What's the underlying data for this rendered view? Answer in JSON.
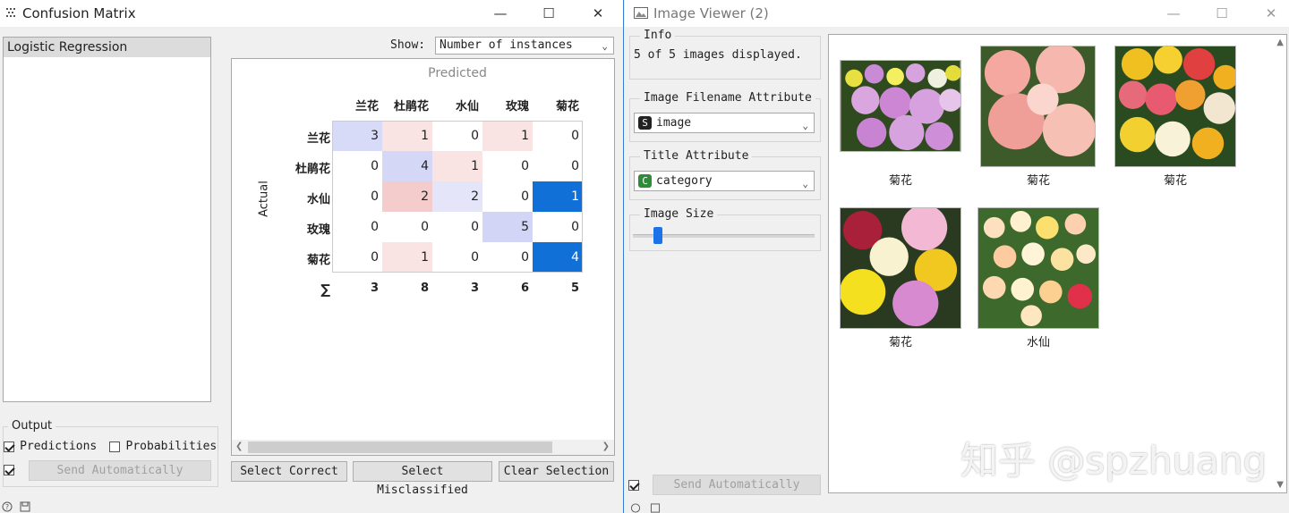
{
  "confusion_window": {
    "title": "Confusion Matrix",
    "classifiers": [
      "Logistic Regression"
    ],
    "show_label": "Show:",
    "show_value": "Number of instances",
    "predicted_label": "Predicted",
    "actual_label": "Actual",
    "classes": [
      "兰花",
      "杜鹃花",
      "水仙",
      "玫瑰",
      "菊花"
    ],
    "matrix": [
      [
        3,
        1,
        0,
        1,
        0
      ],
      [
        0,
        4,
        1,
        0,
        0
      ],
      [
        0,
        2,
        2,
        0,
        1
      ],
      [
        0,
        0,
        0,
        5,
        0
      ],
      [
        0,
        1,
        0,
        0,
        4
      ]
    ],
    "cell_colors": [
      [
        "#d8dbf7",
        "#f9e3e3",
        "#ffffff",
        "#f9e3e3",
        "#ffffff"
      ],
      [
        "#ffffff",
        "#d4d7f6",
        "#f9e3e3",
        "#ffffff",
        "#ffffff"
      ],
      [
        "#ffffff",
        "#f4cccc",
        "#e4e5f9",
        "#ffffff",
        "#1070d8"
      ],
      [
        "#ffffff",
        "#ffffff",
        "#ffffff",
        "#d2d5f6",
        "#ffffff"
      ],
      [
        "#ffffff",
        "#f9e3e3",
        "#ffffff",
        "#ffffff",
        "#1070d8"
      ]
    ],
    "sum_symbol": "∑",
    "column_sums": [
      3,
      8,
      3,
      6,
      5
    ],
    "output_title": "Output",
    "predictions_label": "Predictions",
    "probabilities_label": "Probabilities",
    "send_auto_label": "Send Automatically",
    "select_correct": "Select Correct",
    "select_misclassified": "Select Misclassified",
    "clear_selection": "Clear Selection"
  },
  "image_window": {
    "title": "Image Viewer (2)",
    "info_title": "Info",
    "info_text": "5 of 5 images displayed.",
    "filename_attr_title": "Image Filename Attribute",
    "filename_attr_badge": "S",
    "filename_attr_value": "image",
    "title_attr_title": "Title Attribute",
    "title_attr_badge": "C",
    "title_attr_value": "category",
    "image_size_title": "Image Size",
    "image_size_value": 0.12,
    "send_auto_label": "Send Automatically",
    "images": [
      {
        "caption": "菊花",
        "flower": "chrysanthemum-pink"
      },
      {
        "caption": "菊花",
        "flower": "chrysanthemum-coral"
      },
      {
        "caption": "菊花",
        "flower": "chrysanthemum-mixed"
      },
      {
        "caption": "菊花",
        "flower": "chrysanthemum-yellow"
      },
      {
        "caption": "水仙",
        "flower": "narcissus"
      }
    ]
  },
  "watermark": "知乎 @spzhuang",
  "colors": {
    "accent": "#1a73e8",
    "selected_cell": "#1070d8"
  }
}
